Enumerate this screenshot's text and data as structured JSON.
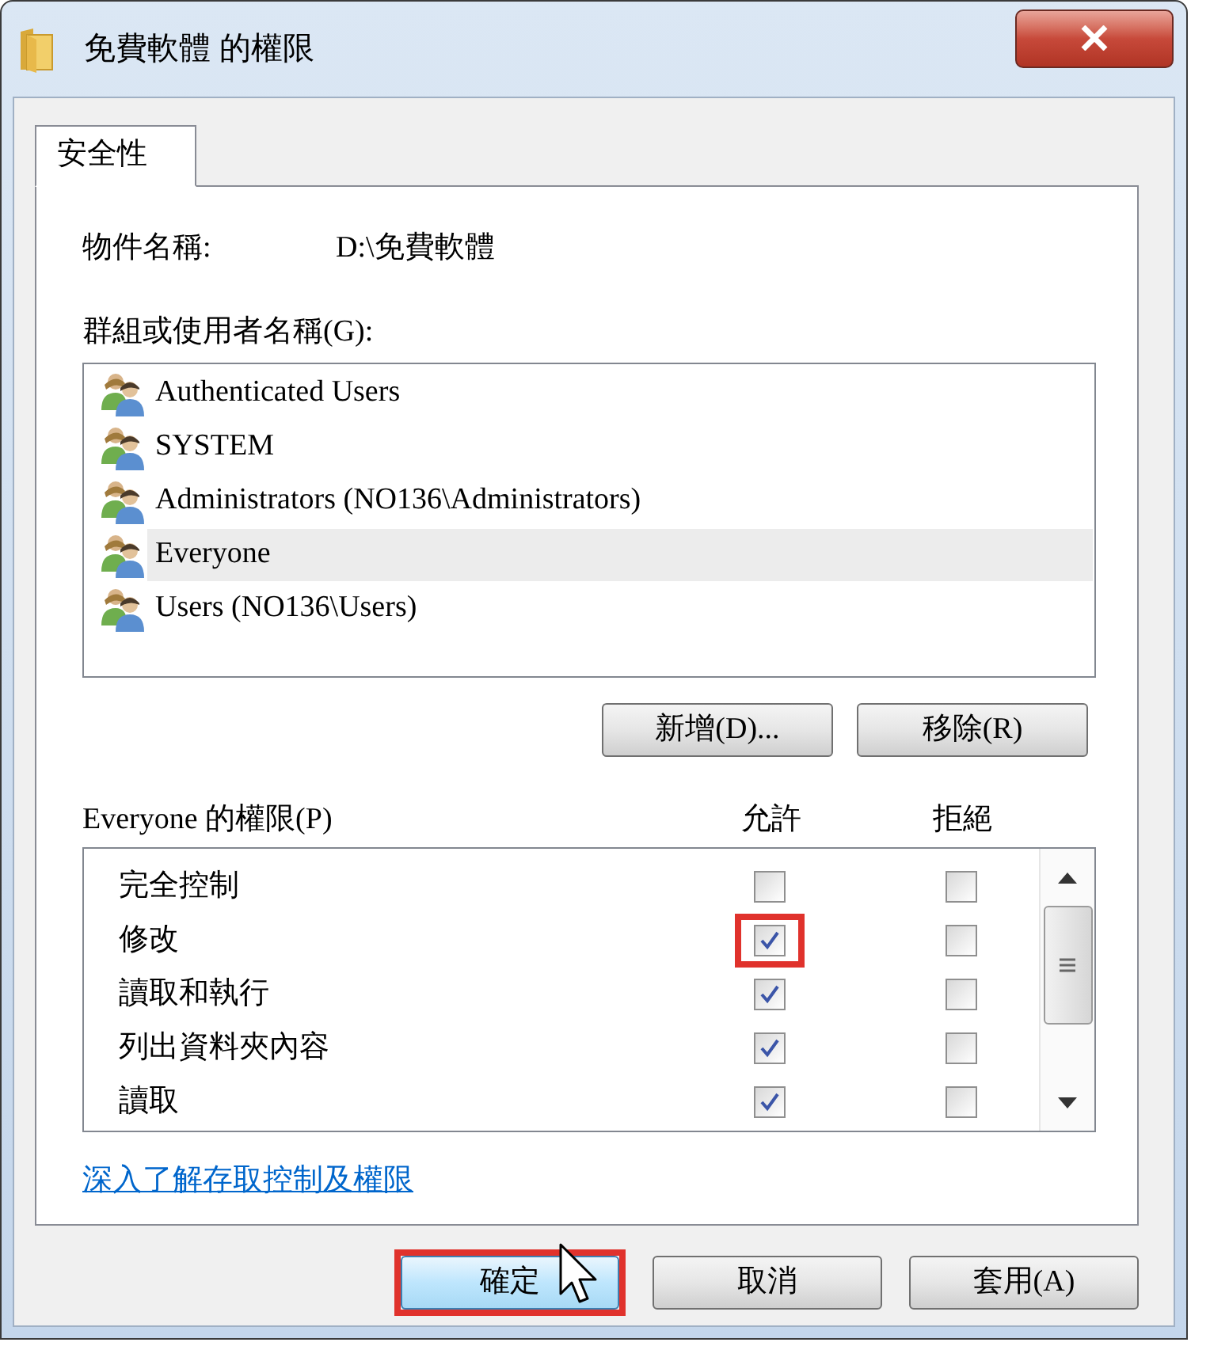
{
  "window": {
    "title": "免費軟體 的權限"
  },
  "tabs": [
    {
      "label": "安全性",
      "selected": true
    }
  ],
  "object_name": {
    "label": "物件名稱:",
    "value": "D:\\免費軟體"
  },
  "groups": {
    "label": "群組或使用者名稱(G):",
    "items": [
      {
        "name": "Authenticated Users",
        "selected": false
      },
      {
        "name": "SYSTEM",
        "selected": false
      },
      {
        "name": "Administrators (NO136\\Administrators)",
        "selected": false
      },
      {
        "name": "Everyone",
        "selected": true
      },
      {
        "name": "Users (NO136\\Users)",
        "selected": false
      }
    ]
  },
  "group_buttons": [
    "新增(D)...",
    "移除(R)"
  ],
  "permissions": {
    "label": "Everyone 的權限(P)",
    "columns": [
      "允許",
      "拒絕"
    ],
    "rows": [
      {
        "name": "完全控制",
        "allow": false,
        "deny": false,
        "highlighted": false
      },
      {
        "name": "修改",
        "allow": true,
        "deny": false,
        "highlighted": true
      },
      {
        "name": "讀取和執行",
        "allow": true,
        "deny": false,
        "highlighted": false
      },
      {
        "name": "列出資料夾內容",
        "allow": true,
        "deny": false,
        "highlighted": false
      },
      {
        "name": "讀取",
        "allow": true,
        "deny": false,
        "highlighted": false
      }
    ]
  },
  "link": "深入了解存取控制及權限",
  "buttons": [
    {
      "label": "確定",
      "hovered": true,
      "highlighted": true
    },
    {
      "label": "取消",
      "hovered": false,
      "highlighted": false
    },
    {
      "label": "套用(A)",
      "hovered": false,
      "highlighted": false
    }
  ]
}
